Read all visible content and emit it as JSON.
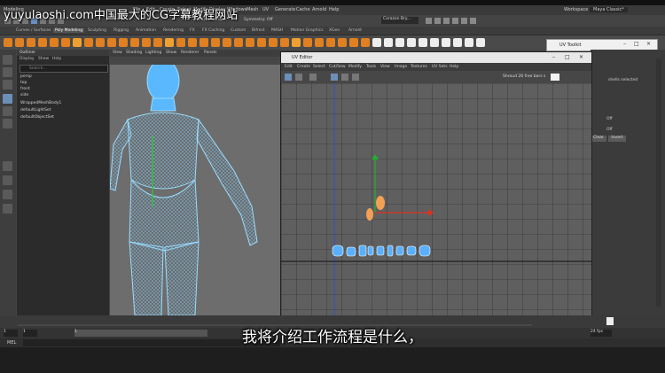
{
  "watermark": "yuyulaoshi.com中国最大的CG字幕教程网站",
  "subtitle": "我将介绍工作流程是什么，",
  "maya_menu": {
    "left": [
      "Modeling"
    ],
    "items": [
      "File",
      "Edit",
      "Create",
      "Select",
      "Modify",
      "Display",
      "Windows",
      "Mesh",
      "Edit Mesh",
      "Mesh Tools",
      "Mesh Display",
      "Curves",
      "Surfaces",
      "Deform",
      "UV",
      "Generate",
      "Cache",
      "Arnold",
      "Help"
    ],
    "workspace_label": "Workspace :",
    "workspace_value": "Maya Classic*"
  },
  "status": {
    "live_surface": "No Live Surface",
    "symmetry": "Symmetry: Off",
    "user_field": "Corazon Bry..."
  },
  "shelf_tabs": [
    "Curves / Surfaces",
    "Poly Modeling",
    "Sculpting",
    "Rigging",
    "Animation",
    "Rendering",
    "FX",
    "FX Caching",
    "Custom",
    "Bifrost",
    "MASH",
    "Motion Graphics",
    "XGen",
    "Arnold"
  ],
  "shelf_active": "Poly Modeling",
  "outliner": {
    "title": "Outliner",
    "menu": [
      "Display",
      "Show",
      "Help"
    ],
    "search_placeholder": "Search...",
    "items": [
      "persp",
      "top",
      "front",
      "side",
      "WrappedMeshBody1",
      "defaultLightSet",
      "defaultObjectSet"
    ]
  },
  "viewport_menu": [
    "View",
    "Shading",
    "Lighting",
    "Show",
    "Renderer",
    "Panels"
  ],
  "uv_editor": {
    "title": "UV Editor",
    "menu": [
      "Edit",
      "Create",
      "Select",
      "Cut/Sew",
      "Modify",
      "Tools",
      "View",
      "Image",
      "Textures",
      "UV Sets",
      "Help"
    ],
    "shaded_label": "Shroud 26 free bars s",
    "status": "(0/69) UV shells, (0/0) overlapping UVs, (0/0) reversed UVs"
  },
  "uv_toolkit": {
    "title": "UV Toolkit"
  },
  "right_panel": {
    "shells_selected": "shells selected",
    "off1": "Off",
    "off2": "Off",
    "clear": "Clear",
    "invert": "Invert"
  },
  "time": {
    "fps": "24 fps",
    "current_frame": "1",
    "start": "1",
    "end": "1"
  },
  "mel_label": "MEL",
  "colors": {
    "shelf_icon": "#e08020",
    "shelf_icon2": "#f0a030",
    "figure": "#5ab8ff",
    "uv_shells": "#5ab0ff",
    "uv_shell_selected": "#f2a055",
    "axis_red": "#e03020",
    "axis_green": "#20b030",
    "axis_blue": "#3050d0"
  }
}
